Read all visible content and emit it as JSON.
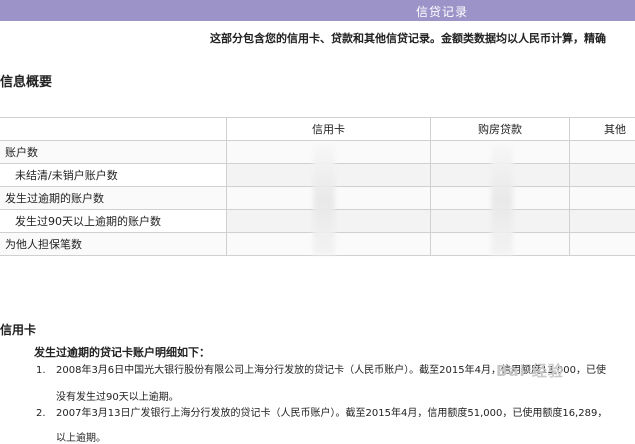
{
  "banner": {
    "title": "信贷记录"
  },
  "notice": "这部分包含您的信用卡、贷款和其他信贷记录。金额类数据均以人民币计算，精确",
  "summary": {
    "title": "信息概要",
    "columns": [
      "",
      "信用卡",
      "购房贷款",
      "其他"
    ],
    "rows": [
      {
        "label": "账户数",
        "level": 1
      },
      {
        "label": "未结清/未销户账户数",
        "level": 2
      },
      {
        "label": "发生过逾期的账户数",
        "level": 1
      },
      {
        "label": "发生过90天以上逾期的账户数",
        "level": 2
      },
      {
        "label": "为他人担保笔数",
        "level": 1
      }
    ]
  },
  "credit_card": {
    "title": "信用卡",
    "subheading": "发生过逾期的贷记卡账户明细如下：",
    "records": [
      {
        "num": "1.",
        "text": "2008年3月6日中国光大银行股份有限公司上海分行发放的贷记卡（人民币账户）。截至2015年4月，信用额度13,000，已使",
        "cont": "没有发生过90天以上逾期。"
      },
      {
        "num": "2.",
        "text": "2007年3月13日广发银行上海分行发放的贷记卡（人民币账户）。截至2015年4月，信用额度51,000，已使用额度16,289，",
        "cont": "以上逾期。"
      }
    ]
  },
  "watermark": "Bai 经验"
}
